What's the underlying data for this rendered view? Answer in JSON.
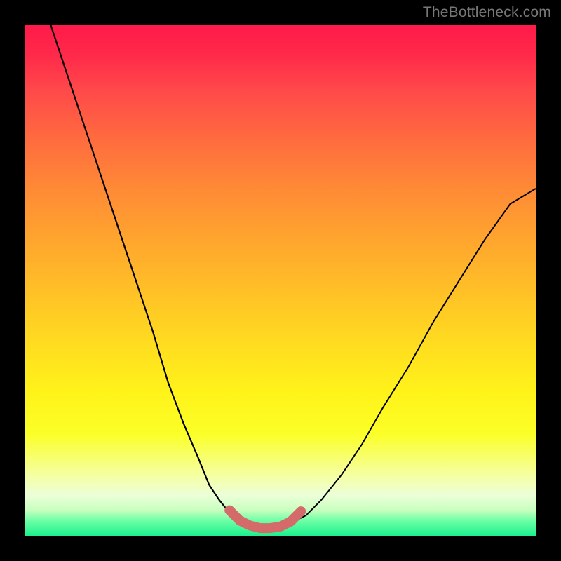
{
  "watermark": "TheBottleneck.com",
  "chart_data": {
    "type": "line",
    "title": "",
    "xlabel": "",
    "ylabel": "",
    "xlim": [
      0,
      100
    ],
    "ylim": [
      0,
      100
    ],
    "grid": false,
    "legend": false,
    "background": {
      "type": "vertical-gradient",
      "stops": [
        {
          "pos": 0,
          "color": "#ff1a4a"
        },
        {
          "pos": 50,
          "color": "#ffc027"
        },
        {
          "pos": 80,
          "color": "#fbff27"
        },
        {
          "pos": 100,
          "color": "#1cf08e"
        }
      ]
    },
    "series": [
      {
        "name": "left-curve",
        "color": "#000000",
        "width": 2,
        "x": [
          5,
          10,
          15,
          20,
          25,
          28,
          31,
          34,
          36,
          38,
          40,
          42,
          44,
          46
        ],
        "y": [
          100,
          85,
          70,
          55,
          40,
          30,
          22,
          15,
          10,
          7,
          4.5,
          3,
          2,
          1.5
        ]
      },
      {
        "name": "right-curve",
        "color": "#000000",
        "width": 2,
        "x": [
          50,
          52,
          55,
          58,
          62,
          66,
          70,
          75,
          80,
          85,
          90,
          95,
          100
        ],
        "y": [
          1.5,
          2.5,
          4,
          7,
          12,
          18,
          25,
          33,
          42,
          50,
          58,
          65,
          68
        ]
      },
      {
        "name": "valley-highlight",
        "color": "#d46a6a",
        "width": 10,
        "x": [
          40,
          42,
          44,
          46,
          48,
          50,
          52,
          54
        ],
        "y": [
          5,
          3,
          2,
          1.5,
          1.5,
          1.8,
          2.8,
          4.8
        ]
      }
    ],
    "markers": [
      {
        "x": 40,
        "y": 5,
        "r": 6,
        "color": "#d46a6a"
      },
      {
        "x": 42,
        "y": 3,
        "r": 6,
        "color": "#d46a6a"
      },
      {
        "x": 50,
        "y": 1.8,
        "r": 6,
        "color": "#d46a6a"
      },
      {
        "x": 52,
        "y": 2.8,
        "r": 6,
        "color": "#d46a6a"
      },
      {
        "x": 54,
        "y": 4.8,
        "r": 6,
        "color": "#d46a6a"
      }
    ]
  }
}
